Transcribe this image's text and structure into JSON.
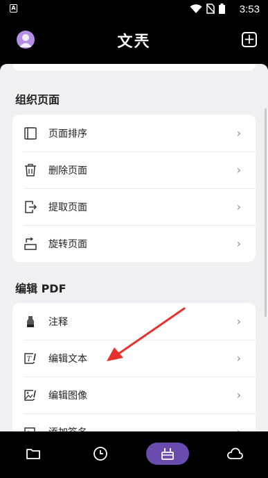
{
  "status_bar": {
    "time": "3:53",
    "notification_icon": "A"
  },
  "header": {
    "title": "文兲",
    "avatar_icon": "user-avatar",
    "add_icon": "plus-square-icon"
  },
  "sections": [
    {
      "title": "组织页面",
      "items": [
        {
          "label": "页面排序",
          "icon": "reorder-pages-icon"
        },
        {
          "label": "删除页面",
          "icon": "trash-icon"
        },
        {
          "label": "提取页面",
          "icon": "extract-page-icon"
        },
        {
          "label": "旋转页面",
          "icon": "rotate-page-icon"
        }
      ]
    },
    {
      "title": "编辑 PDF",
      "items": [
        {
          "label": "注释",
          "icon": "highlighter-icon"
        },
        {
          "label": "编辑文本",
          "icon": "edit-text-icon"
        },
        {
          "label": "编辑图像",
          "icon": "edit-image-icon"
        },
        {
          "label": "添加签名",
          "icon": "signature-icon"
        }
      ]
    }
  ],
  "bottom_nav": [
    {
      "name": "files",
      "icon": "folder-icon",
      "active": false
    },
    {
      "name": "recent",
      "icon": "clock-icon",
      "active": false
    },
    {
      "name": "tools",
      "icon": "toolbox-icon",
      "active": true
    },
    {
      "name": "cloud",
      "icon": "cloud-icon",
      "active": false
    }
  ],
  "colors": {
    "accent": "#6a4caf",
    "annotation_arrow": "#e8312a",
    "background": "#f0f0f2"
  }
}
